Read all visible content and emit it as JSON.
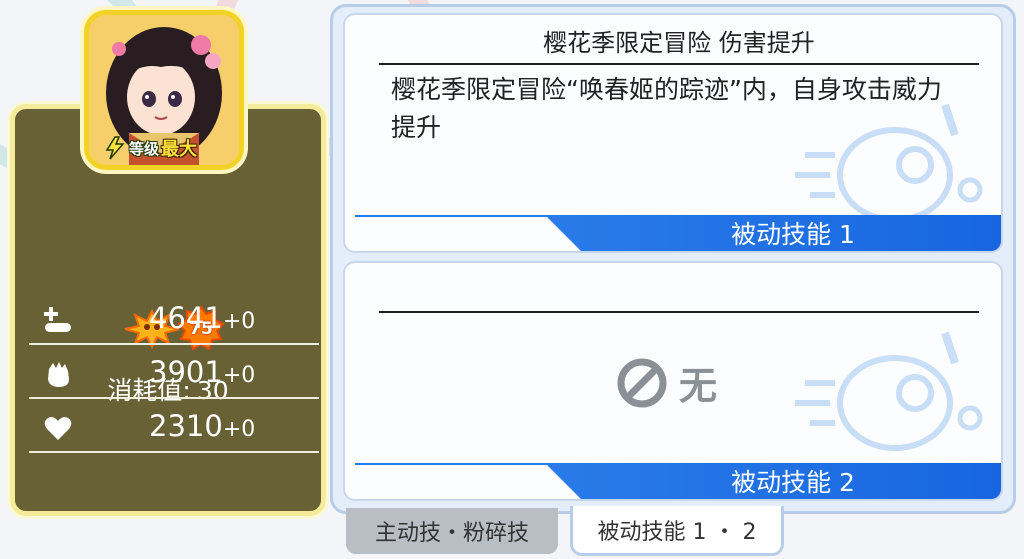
{
  "character": {
    "level_label": "等级",
    "level_value": "最大",
    "rarity_value": "75",
    "cost_label": "消耗值:",
    "cost_value": "30",
    "stats": [
      {
        "icon": "hp-plus-icon",
        "value": "4641",
        "bonus": "+0"
      },
      {
        "icon": "fist-attack-icon",
        "value": "3901",
        "bonus": "+0"
      },
      {
        "icon": "heart-icon",
        "value": "2310",
        "bonus": "+0"
      }
    ]
  },
  "skills": {
    "passive1": {
      "title": "樱花季限定冒险 伤害提升",
      "description": "樱花季限定冒险“唤春姬的踪迹”内，自身攻击威力提升",
      "ribbon_label": "被动技能 1"
    },
    "passive2": {
      "title": "",
      "none_label": "无",
      "ribbon_label": "被动技能 2"
    }
  },
  "tabs": {
    "active_skill": "主动技・粉碎技",
    "passive_skills": "被动技能 1 ・ 2"
  },
  "colors": {
    "panel": "#696136",
    "ribbon": "#2a7be9",
    "portrait_frame": "#f2d225"
  }
}
